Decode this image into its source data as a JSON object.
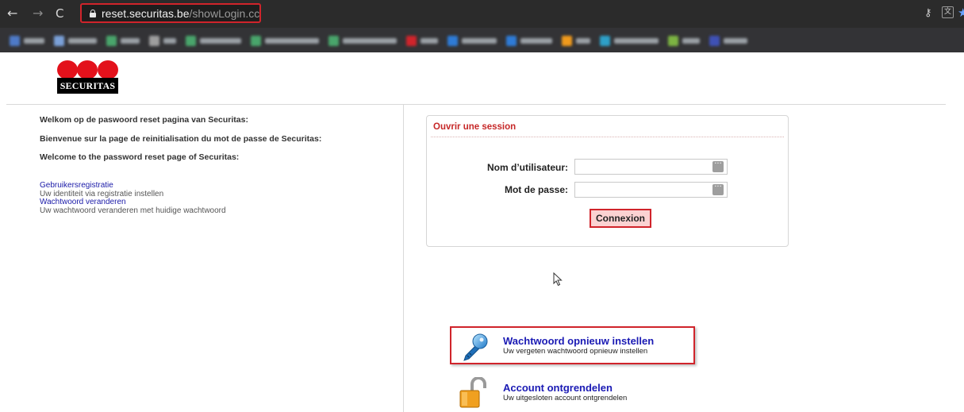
{
  "browser": {
    "url_host": "reset.securitas.be",
    "url_path": "/showLogin.cc",
    "bookmarks": [
      {
        "color": "#4e7ac7",
        "w": 26
      },
      {
        "color": "#7aa0d8",
        "w": 36
      },
      {
        "color": "#49a56b",
        "w": 24
      },
      {
        "color": "#9e9e9e",
        "w": 16
      },
      {
        "color": "#49a56b",
        "w": 52
      },
      {
        "color": "#49a56b",
        "w": 68
      },
      {
        "color": "#49a56b",
        "w": 68
      },
      {
        "color": "#d0242b",
        "w": 22
      },
      {
        "color": "#2e7bd6",
        "w": 44
      },
      {
        "color": "#2e7bd6",
        "w": 40
      },
      {
        "color": "#f09a1c",
        "w": 18
      },
      {
        "color": "#2ea0c8",
        "w": 56
      },
      {
        "color": "#7cb342",
        "w": 22
      },
      {
        "color": "#3f51b5",
        "w": 30
      }
    ]
  },
  "logo": {
    "text": "SECURITAS"
  },
  "welcome": {
    "line1": "Welkom op de paswoord reset pagina van Securitas:",
    "line2": "Bienvenue sur la page de reinitialisation du mot de passe de Securitas:",
    "line3": "Welcome to the password reset page of Securitas:"
  },
  "links": {
    "registration_label": "Gebruikersregistratie",
    "registration_desc": "Uw identiteit via registratie instellen",
    "change_label": "Wachtwoord veranderen",
    "change_desc": "Uw wachtwoord veranderen met huidige wachtwoord"
  },
  "login": {
    "title": "Ouvrir une session",
    "username_label": "Nom d’utilisateur:",
    "username_value": "",
    "password_label": "Mot de passe:",
    "password_value": "",
    "submit_label": "Connexion"
  },
  "actions": {
    "reset_title": "Wachtwoord opnieuw instellen",
    "reset_desc": "Uw vergeten wachtwoord opnieuw instellen",
    "unlock_title": "Account ontgrendelen",
    "unlock_desc": "Uw uitgesloten account ontgrendelen"
  },
  "colors": {
    "brand_red": "#e3111b",
    "highlight_red": "#d0242b",
    "link_blue": "#1a1ab4"
  }
}
